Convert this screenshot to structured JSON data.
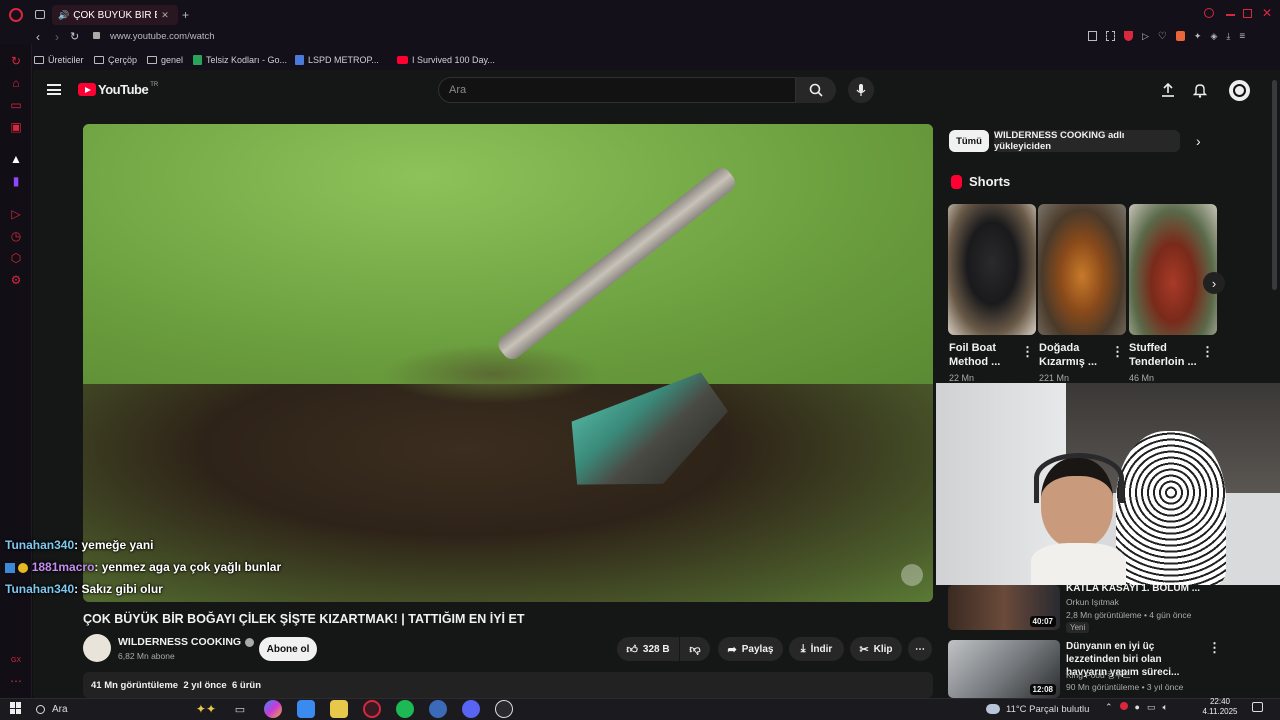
{
  "browser": {
    "tab_title": "ÇOK BÜYÜK BİR BOĞ",
    "url": "www.youtube.com/watch",
    "bookmarks": [
      "Üreticiler",
      "Çerçöp",
      "genel",
      "Telsiz Kodları - Go...",
      "LSPD METROP...",
      "I Survived 100 Day..."
    ]
  },
  "youtube": {
    "logo_text": "YouTube",
    "logo_region": "TR",
    "search_placeholder": "Ara",
    "video": {
      "title": "ÇOK BÜYÜK BİR BOĞAYI ÇİLEK ŞİŞTE KIZARTMAK! | TATTIĞIM EN İYİ ET",
      "channel": "WILDERNESS COOKING",
      "subscribers": "6,82 Mn abone",
      "subscribe_label": "Abone ol",
      "likes": "328 B",
      "share_label": "Paylaş",
      "download_label": "İndir",
      "clip_label": "Klip",
      "desc_views": "41 Mn görüntüleme",
      "desc_age": "2 yıl önce",
      "desc_products": "6 ürün"
    },
    "chips": [
      "Tümü",
      "WILDERNESS COOKING adlı yükleyiciden"
    ],
    "shorts_label": "Shorts",
    "shorts": [
      {
        "title": "Foil Boat Method ...",
        "views": "22 Mn"
      },
      {
        "title": "Doğada Kızarmış ...",
        "views": "221 Mn"
      },
      {
        "title": "Stuffed Tenderloin ...",
        "views": "46 Mn"
      }
    ],
    "recommended": [
      {
        "title": "KATLA KASAYI 1. BÖLÜM ...",
        "channel": "Orkun Işıtmak",
        "meta": "2,8 Mn görüntüleme • 4 gün önce",
        "badge": "Yeni",
        "duration": "40:07"
      },
      {
        "title": "Dünyanın en iyi üç lezzetinden biri olan havyarın yapım süreci...",
        "channel": "King Food 킹푸드",
        "meta": "90 Mn görüntüleme • 3 yıl önce",
        "duration": "12:08"
      }
    ]
  },
  "chat": [
    {
      "user": "Tunahan340",
      "message": ": yemeğe yani"
    },
    {
      "user": "1881macro",
      "message": ": yenmez aga ya çok yağlı bunlar"
    },
    {
      "user": "Tunahan340",
      "message": ": Sakız gibi olur"
    }
  ],
  "taskbar": {
    "search_label": "Ara",
    "weather": "11°C  Parçalı bulutlu",
    "time": "22:40",
    "date": "4.11.2025"
  },
  "colors": {
    "accent_red": "#ff0033",
    "opera_red": "#d9273e",
    "bg": "#0f0f0f"
  }
}
